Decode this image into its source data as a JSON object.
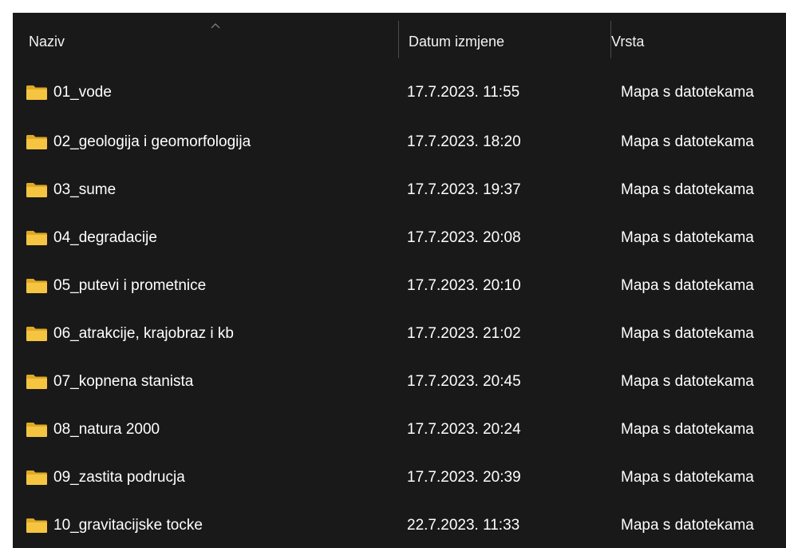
{
  "columns": {
    "name": "Naziv",
    "date": "Datum izmjene",
    "type": "Vrsta"
  },
  "sort": {
    "column": "name",
    "direction": "ascending",
    "icon": "chevron-up-icon"
  },
  "colors": {
    "background": "#191919",
    "text": "#ffffff",
    "folder": "#f5c542",
    "separator": "#4a4a4a"
  },
  "rows": [
    {
      "name": "01_vode",
      "date": "17.7.2023. 11:55",
      "type": "Mapa s datotekama",
      "icon": "folder-icon"
    },
    {
      "name": "02_geologija i geomorfologija",
      "date": "17.7.2023. 18:20",
      "type": "Mapa s datotekama",
      "icon": "folder-icon"
    },
    {
      "name": "03_sume",
      "date": "17.7.2023. 19:37",
      "type": "Mapa s datotekama",
      "icon": "folder-icon"
    },
    {
      "name": "04_degradacije",
      "date": "17.7.2023. 20:08",
      "type": "Mapa s datotekama",
      "icon": "folder-icon"
    },
    {
      "name": "05_putevi i prometnice",
      "date": "17.7.2023. 20:10",
      "type": "Mapa s datotekama",
      "icon": "folder-icon"
    },
    {
      "name": "06_atrakcije, krajobraz i kb",
      "date": "17.7.2023. 21:02",
      "type": "Mapa s datotekama",
      "icon": "folder-icon"
    },
    {
      "name": "07_kopnena stanista",
      "date": "17.7.2023. 20:45",
      "type": "Mapa s datotekama",
      "icon": "folder-icon"
    },
    {
      "name": "08_natura 2000",
      "date": "17.7.2023. 20:24",
      "type": "Mapa s datotekama",
      "icon": "folder-icon"
    },
    {
      "name": "09_zastita podrucja",
      "date": "17.7.2023. 20:39",
      "type": "Mapa s datotekama",
      "icon": "folder-icon"
    },
    {
      "name": "10_gravitacijske tocke",
      "date": "22.7.2023. 11:33",
      "type": "Mapa s datotekama",
      "icon": "folder-icon"
    }
  ]
}
